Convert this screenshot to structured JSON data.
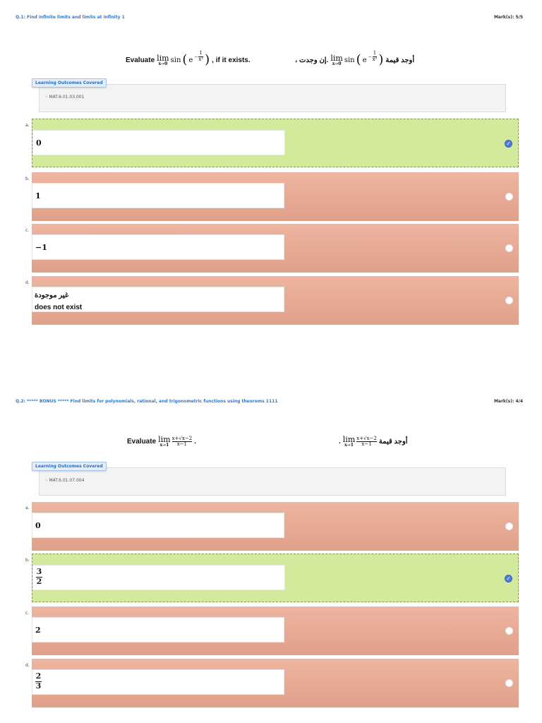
{
  "questions": [
    {
      "title": "Q.1: Find infinite limits and limits at infinity 1",
      "mark": "Mark(s): 5/5",
      "prompt_en_prefix": "Evaluate",
      "prompt_en_suffix": ", if it exists.",
      "prompt_ar_prefix": "أوجد قيمة",
      "prompt_ar_suffix": "، إن وجدت.",
      "lim_word": "lim",
      "lim_sub": "x→0",
      "func_text": "sin",
      "exp_base": "e",
      "exp_num": "1",
      "exp_den": "x²",
      "lo_label": "Learning Outcomes Covered",
      "lo_item": "MAT.6.01.03.001",
      "options": [
        {
          "letter": "a.",
          "value": "0",
          "correct": true
        },
        {
          "letter": "b.",
          "value": "1",
          "correct": false
        },
        {
          "letter": "c.",
          "value": "−1",
          "correct": false
        },
        {
          "letter": "d.",
          "value_ar": "غير موجودة",
          "value_en": "does not exist",
          "correct": false
        }
      ]
    },
    {
      "title": "Q.2: ***** BONUS ***** Find limits for polynomials, rational, and trigonometric functions using theorems 1111",
      "mark": "Mark(s): 4/4",
      "prompt_en_prefix": "Evaluate",
      "prompt_en_suffix": ".",
      "prompt_ar_prefix": "أوجد قيمة",
      "prompt_ar_suffix": ".",
      "lim_word": "lim",
      "lim_sub": "x→1",
      "frac_num": "x+√x−2",
      "frac_den": "x−1",
      "lo_label": "Learning Outcomes Covered",
      "lo_item": "MAT.6.01.07.004",
      "options": [
        {
          "letter": "a.",
          "value": "0",
          "correct": false
        },
        {
          "letter": "b.",
          "num": "3",
          "den": "2",
          "correct": true
        },
        {
          "letter": "c.",
          "value": "2",
          "correct": false
        },
        {
          "letter": "d.",
          "num": "2",
          "den": "3",
          "correct": false
        }
      ]
    }
  ],
  "icons": {
    "checked_radio": "check-circle-icon",
    "unchecked_radio": "radio-empty-icon"
  },
  "colors": {
    "title_link": "#2a7bd3",
    "correct_bg": "#d3ea9c",
    "incorrect_bg": "#eeb5a0",
    "radio_checked": "#4a7bd2"
  }
}
